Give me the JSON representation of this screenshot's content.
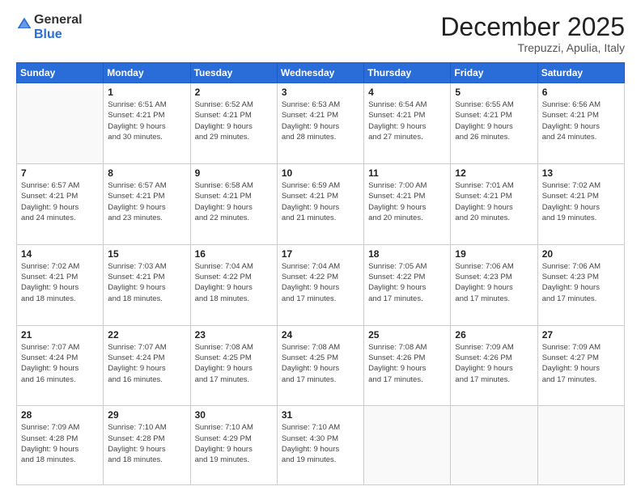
{
  "header": {
    "logo_general": "General",
    "logo_blue": "Blue",
    "month_title": "December 2025",
    "location": "Trepuzzi, Apulia, Italy"
  },
  "calendar": {
    "days_of_week": [
      "Sunday",
      "Monday",
      "Tuesday",
      "Wednesday",
      "Thursday",
      "Friday",
      "Saturday"
    ],
    "weeks": [
      [
        {
          "day": "",
          "info": ""
        },
        {
          "day": "1",
          "info": "Sunrise: 6:51 AM\nSunset: 4:21 PM\nDaylight: 9 hours\nand 30 minutes."
        },
        {
          "day": "2",
          "info": "Sunrise: 6:52 AM\nSunset: 4:21 PM\nDaylight: 9 hours\nand 29 minutes."
        },
        {
          "day": "3",
          "info": "Sunrise: 6:53 AM\nSunset: 4:21 PM\nDaylight: 9 hours\nand 28 minutes."
        },
        {
          "day": "4",
          "info": "Sunrise: 6:54 AM\nSunset: 4:21 PM\nDaylight: 9 hours\nand 27 minutes."
        },
        {
          "day": "5",
          "info": "Sunrise: 6:55 AM\nSunset: 4:21 PM\nDaylight: 9 hours\nand 26 minutes."
        },
        {
          "day": "6",
          "info": "Sunrise: 6:56 AM\nSunset: 4:21 PM\nDaylight: 9 hours\nand 24 minutes."
        }
      ],
      [
        {
          "day": "7",
          "info": "Sunrise: 6:57 AM\nSunset: 4:21 PM\nDaylight: 9 hours\nand 24 minutes."
        },
        {
          "day": "8",
          "info": "Sunrise: 6:57 AM\nSunset: 4:21 PM\nDaylight: 9 hours\nand 23 minutes."
        },
        {
          "day": "9",
          "info": "Sunrise: 6:58 AM\nSunset: 4:21 PM\nDaylight: 9 hours\nand 22 minutes."
        },
        {
          "day": "10",
          "info": "Sunrise: 6:59 AM\nSunset: 4:21 PM\nDaylight: 9 hours\nand 21 minutes."
        },
        {
          "day": "11",
          "info": "Sunrise: 7:00 AM\nSunset: 4:21 PM\nDaylight: 9 hours\nand 20 minutes."
        },
        {
          "day": "12",
          "info": "Sunrise: 7:01 AM\nSunset: 4:21 PM\nDaylight: 9 hours\nand 20 minutes."
        },
        {
          "day": "13",
          "info": "Sunrise: 7:02 AM\nSunset: 4:21 PM\nDaylight: 9 hours\nand 19 minutes."
        }
      ],
      [
        {
          "day": "14",
          "info": "Sunrise: 7:02 AM\nSunset: 4:21 PM\nDaylight: 9 hours\nand 18 minutes."
        },
        {
          "day": "15",
          "info": "Sunrise: 7:03 AM\nSunset: 4:21 PM\nDaylight: 9 hours\nand 18 minutes."
        },
        {
          "day": "16",
          "info": "Sunrise: 7:04 AM\nSunset: 4:22 PM\nDaylight: 9 hours\nand 18 minutes."
        },
        {
          "day": "17",
          "info": "Sunrise: 7:04 AM\nSunset: 4:22 PM\nDaylight: 9 hours\nand 17 minutes."
        },
        {
          "day": "18",
          "info": "Sunrise: 7:05 AM\nSunset: 4:22 PM\nDaylight: 9 hours\nand 17 minutes."
        },
        {
          "day": "19",
          "info": "Sunrise: 7:06 AM\nSunset: 4:23 PM\nDaylight: 9 hours\nand 17 minutes."
        },
        {
          "day": "20",
          "info": "Sunrise: 7:06 AM\nSunset: 4:23 PM\nDaylight: 9 hours\nand 17 minutes."
        }
      ],
      [
        {
          "day": "21",
          "info": "Sunrise: 7:07 AM\nSunset: 4:24 PM\nDaylight: 9 hours\nand 16 minutes."
        },
        {
          "day": "22",
          "info": "Sunrise: 7:07 AM\nSunset: 4:24 PM\nDaylight: 9 hours\nand 16 minutes."
        },
        {
          "day": "23",
          "info": "Sunrise: 7:08 AM\nSunset: 4:25 PM\nDaylight: 9 hours\nand 17 minutes."
        },
        {
          "day": "24",
          "info": "Sunrise: 7:08 AM\nSunset: 4:25 PM\nDaylight: 9 hours\nand 17 minutes."
        },
        {
          "day": "25",
          "info": "Sunrise: 7:08 AM\nSunset: 4:26 PM\nDaylight: 9 hours\nand 17 minutes."
        },
        {
          "day": "26",
          "info": "Sunrise: 7:09 AM\nSunset: 4:26 PM\nDaylight: 9 hours\nand 17 minutes."
        },
        {
          "day": "27",
          "info": "Sunrise: 7:09 AM\nSunset: 4:27 PM\nDaylight: 9 hours\nand 17 minutes."
        }
      ],
      [
        {
          "day": "28",
          "info": "Sunrise: 7:09 AM\nSunset: 4:28 PM\nDaylight: 9 hours\nand 18 minutes."
        },
        {
          "day": "29",
          "info": "Sunrise: 7:10 AM\nSunset: 4:28 PM\nDaylight: 9 hours\nand 18 minutes."
        },
        {
          "day": "30",
          "info": "Sunrise: 7:10 AM\nSunset: 4:29 PM\nDaylight: 9 hours\nand 19 minutes."
        },
        {
          "day": "31",
          "info": "Sunrise: 7:10 AM\nSunset: 4:30 PM\nDaylight: 9 hours\nand 19 minutes."
        },
        {
          "day": "",
          "info": ""
        },
        {
          "day": "",
          "info": ""
        },
        {
          "day": "",
          "info": ""
        }
      ]
    ]
  }
}
